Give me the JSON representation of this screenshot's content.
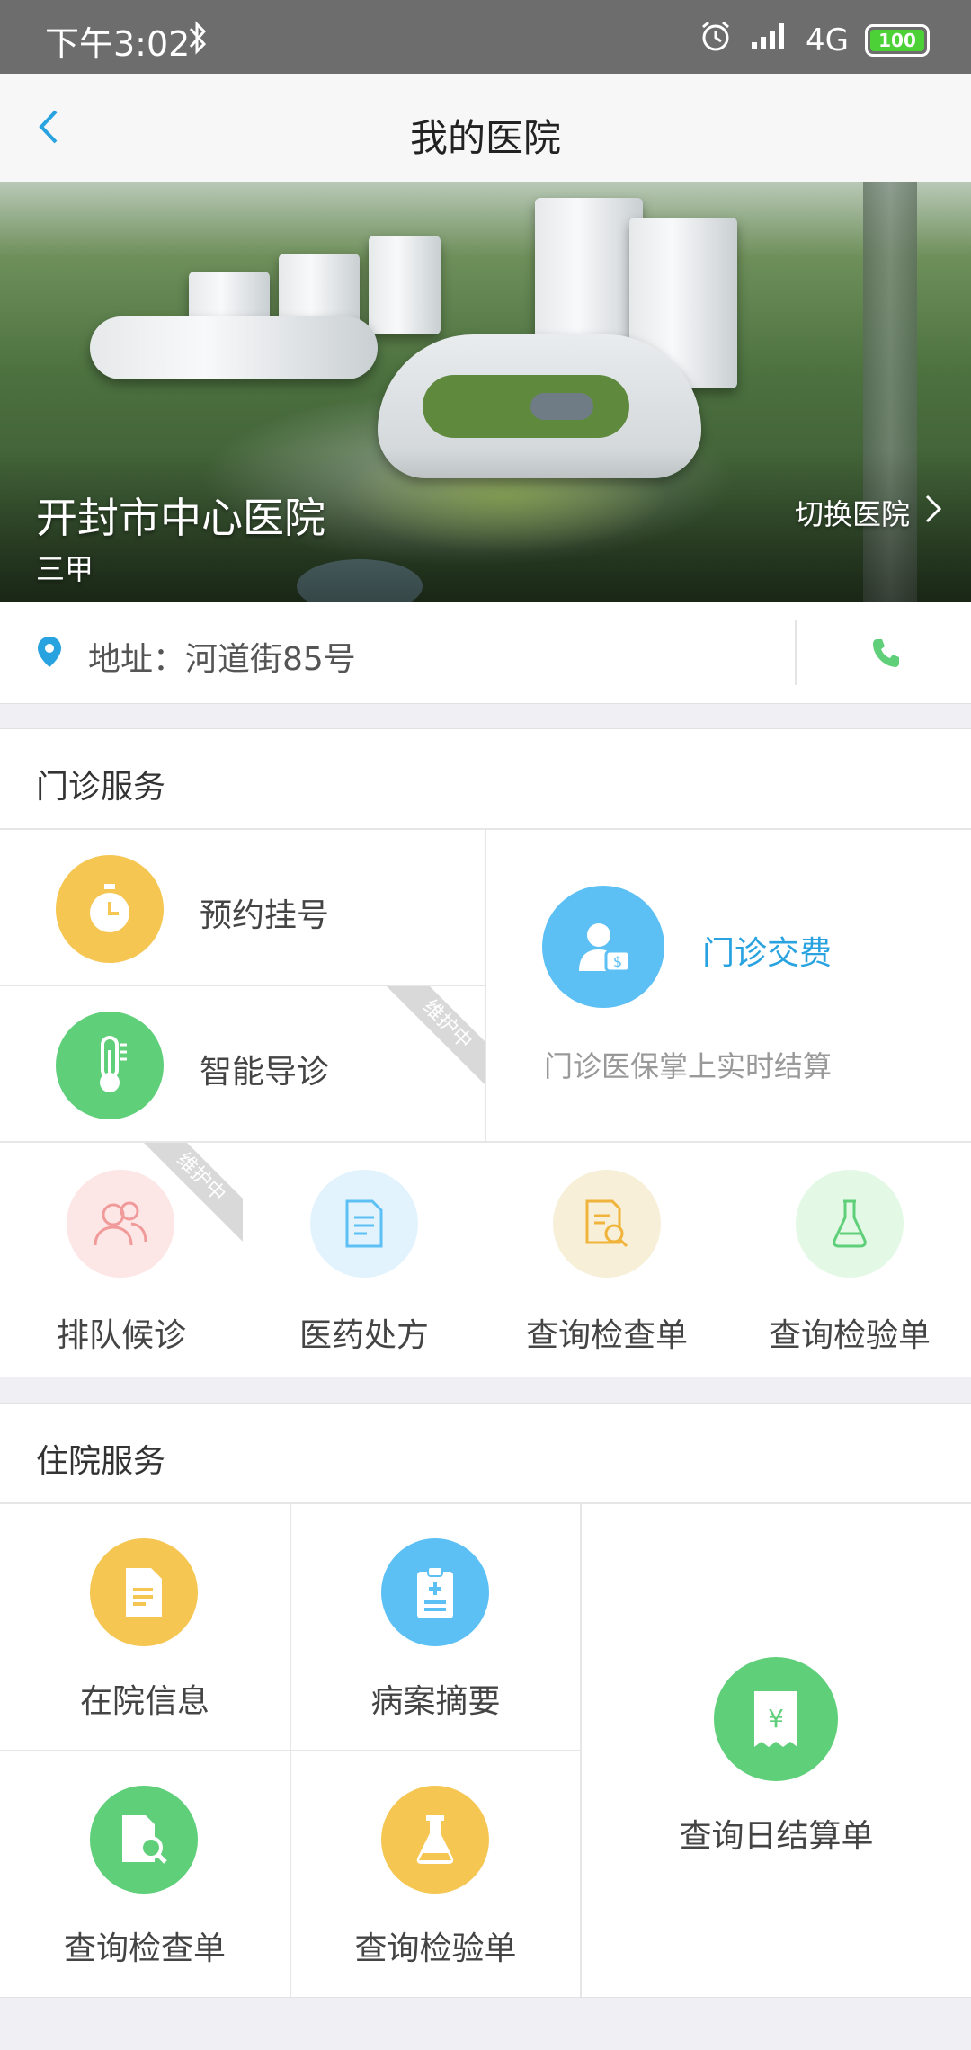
{
  "status_bar": {
    "time": "下午3:02",
    "network": "4G",
    "battery": "100"
  },
  "header": {
    "title": "我的医院"
  },
  "hospital": {
    "name": "开封市中心医院",
    "level": "三甲",
    "switch_label": "切换医院"
  },
  "address": {
    "text": "地址：河道街85号"
  },
  "outpatient": {
    "title": "门诊服务",
    "appointment": "预约挂号",
    "triage": "智能导诊",
    "maintenance": "维护中",
    "payment": {
      "title": "门诊交费",
      "desc": "门诊医保掌上实时结算"
    },
    "grid": [
      "排队候诊",
      "医药处方",
      "查询检查单",
      "查询检验单"
    ]
  },
  "inpatient": {
    "title": "住院服务",
    "items": [
      "在院信息",
      "病案摘要",
      "查询检查单",
      "查询检验单"
    ],
    "daily_bill": "查询日结算单"
  },
  "colors": {
    "accent": "#29a3e0",
    "yellow": "#f5c652",
    "green": "#5fcf7a",
    "blue": "#5cc0f5"
  }
}
